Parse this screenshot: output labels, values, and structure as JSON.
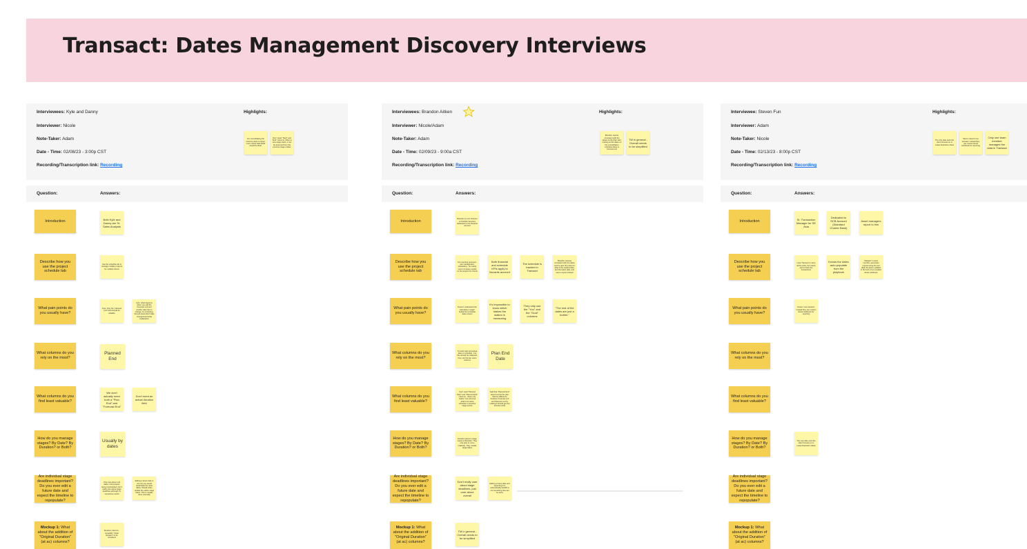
{
  "title": "Transact: Dates Management Discovery Interviews",
  "colors": {
    "banner": "#f8d4df",
    "question_sticky": "#f5cf52",
    "answer_sticky": "#fff7a8",
    "link": "#1f6feb"
  },
  "labels": {
    "highlights": "Highlights:",
    "question": "Question:",
    "answers": "Answers:",
    "interviewees": "Interviewees:",
    "interviewee": "Interviewee:",
    "interviewer": "Interviewer:",
    "note_taker": "Note-Taker:",
    "date_time": "Date - Time:",
    "recording": "Recording/Transcription link:"
  },
  "questions": {
    "introduction": "Introduction",
    "describe": "Describe how you use the project schedule tab",
    "pain": "What pain points do you usually have?",
    "rely": "What columns do you rely on the most?",
    "least": "What columns do you find least valuable?",
    "stages": "How do you manage stages? By Date? By Duration? or Both?",
    "deadlines": "Are individual stage deadlines important? Do you ever edit a future date and expect the timeline to repopulate?",
    "mockup_bold": "Mockup 1:",
    "mockup_rest": "What about the addition of \"Original Duration\" (at ac) columns?"
  },
  "interviews": [
    {
      "interviewees": "Kyle and Danny",
      "interviewer": "Nicole",
      "note_taker": "Adam",
      "date_time": "02/08/23 - 3:00p CST",
      "recording_link": "Recording",
      "highlights": [
        "For consolidating the columns down to fewer, more critical data fields would be ideal.",
        "Don't need \"Start\" and \"End\" columns. When a new stage starts, it can be assumed from the previous stage ended."
      ],
      "answers": {
        "introduction": [
          "Both Kyle and Danny are Sr. Sales Analysts"
        ],
        "describe": [
          "Use the schedule tab to manage multiple projects for multiple clients"
        ],
        "pain": [
          "Kyle: Only the \"planned end\" field should be editable",
          "Kyle: what happens when you edit the Forecast end and another date has to change; it's confusing. Should show which date changed and what explanation"
        ],
        "rely": [
          "Planned End"
        ],
        "least": [
          "We don't actually need both a \"Plan End\" and \"Forecast End\"",
          "Don't need an actual duration field"
        ],
        "stages": [
          "Usually by dates"
        ],
        "deadlines": [
          "Only care about end dates, hold projects being rescheduled. Don't really care about stage deadlines although it's sometimes useful",
          "Editing a future date is not one you would recalculate the other dates. Would rather update the earlier stage dates. This is usually done manually"
        ],
        "mockup": [
          "Duration columns - Hopefully \"Initial Duration\" is be consistent"
        ]
      }
    },
    {
      "interviewees": "Brandon Aitken",
      "interviewer": "Nicole/Adam",
      "note_taker": "Adam",
      "date_time": "02/09/23 - 9:00a CST",
      "recording_link": "Recording",
      "highlights": [
        "Brandon reports consistent with the values of the Plan start, nothing at this dates on the consolidation schedule dates is forecast end",
        "TM in general - Overall needs to be simplified"
      ],
      "answers": {
        "introduction": [
          "Brandon is a Sr. Director of Portfolio Services dedicated to the Novartis account"
        ],
        "describe": [
          "No reporting purposes, risk management, scheduling - he mainly uses it to keep a pulse on his projects for clients",
          "Both financial and schedule KPIs apply to Novartis account",
          "The schedule is tracked in Transact",
          "Brandon reviews consistent with the dates and he gets the pulse for what is the earliest date, and the latest date, and uses a report instead"
        ],
        "pain": [
          "Doesn't understand the calculating \"magic\" behind the schedule dates shown",
          "It's impossible to know which stakes the station is measuring",
          "They only use the \"You\" and the \"Goal\" columns",
          "\"The rest of the dates are just a bother.\""
        ],
        "rely": [
          "To track start and actual date on schedule - but this should be collapsed, they use the two same columns",
          "Plan End Date"
        ],
        "least": [
          "Can't read \"Planned Start\" and \"Planned End\" columns - these only matter if we all know what's the same schedule in previous stage events",
          "Said that \"Planned End\" doesn't know the plan that the difference between Forecast end and Planned end by relating it should get lost forecast ends"
        ],
        "stages": [
          "Duration doesn't usage cause to Brandon. They only plan to move relatively. They usually target dates"
        ],
        "deadlines": [
          "Don't really care about stage deadlines, just care about overall",
          "Editing a future date and expecting it to automatically backfill is not something that can be done"
        ],
        "mockup": [
          "TM in general - Overall needs to be simplified"
        ]
      }
    },
    {
      "interviewees": "Steven Fun",
      "interviewer": "Adam",
      "note_taker": "Nicole",
      "date_time": "02/13/23 - 8:00p CST",
      "recording_link": "Recording",
      "highlights": [
        "The only date point the client focuses on is Lease Expiration dates",
        "Steven doesn't use transact; instead they use custom Excel workbook for reporting",
        "Only one team member manages the data in Transact"
      ],
      "answers": {
        "introduction": [
          "Sr. Transaction Manager for SE Asia",
          "Dedicated to SCB Account (Standard Charter Bank)",
          "Asset managers report to him"
        ],
        "describe": [
          "Uses Transact to store all the work, but mainly just to track live transactions",
          "Knows the dates auto-populate from the playbook",
          "\"Dataset\" is team member, generates reports using the tool data; the given updated in the form of an emailed Excel workbook"
        ],
        "pain": [
          "Doesn't use transact; instead they use custom Excel workbook for reporting"
        ],
        "rely": [],
        "least": [],
        "stages": [
          "The only date point the client focuses on is Lease Expiration dates"
        ],
        "deadlines": [],
        "mockup": []
      }
    }
  ]
}
